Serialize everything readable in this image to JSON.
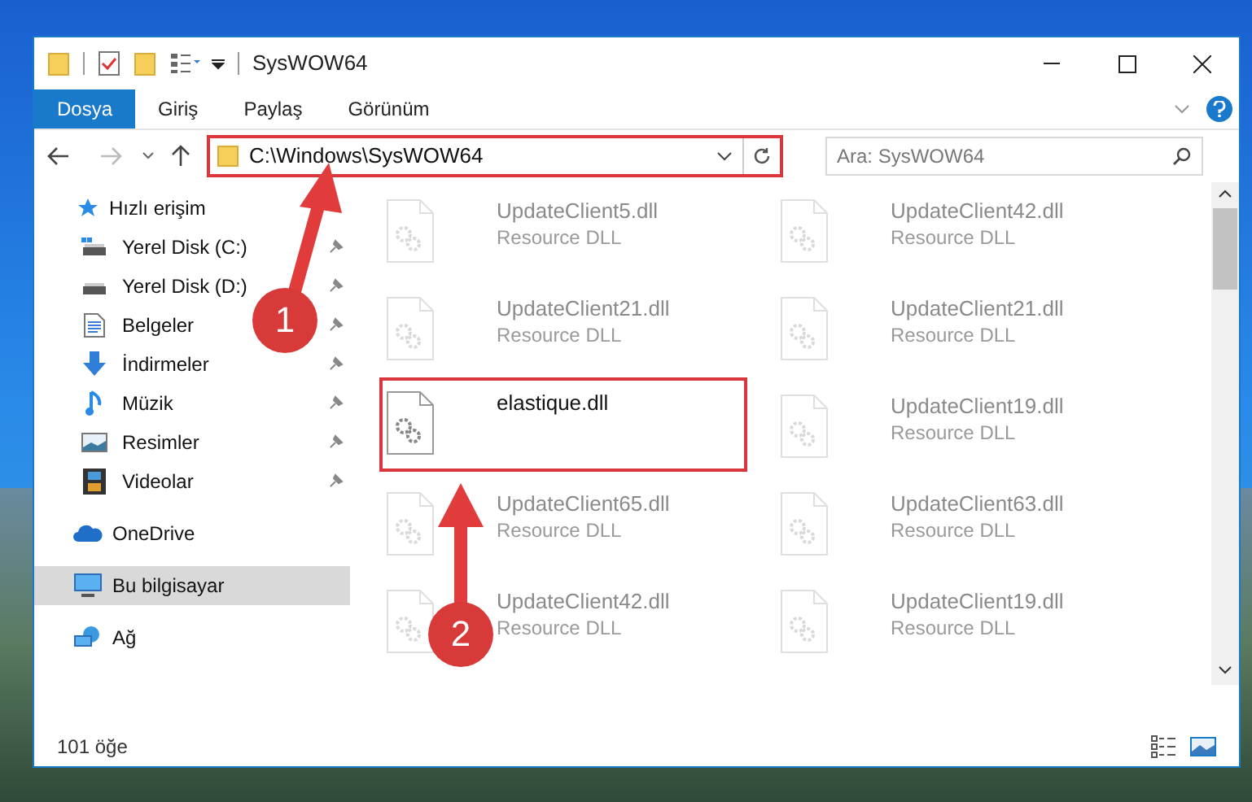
{
  "window": {
    "title": "SysWOW64"
  },
  "ribbon_tabs": [
    {
      "label": "Dosya",
      "selected": true
    },
    {
      "label": "Giriş",
      "selected": false
    },
    {
      "label": "Paylaş",
      "selected": false
    },
    {
      "label": "Görünüm",
      "selected": false
    }
  ],
  "address": {
    "path": "C:\\Windows\\SysWOW64",
    "highlighted": true
  },
  "search": {
    "placeholder": "Ara: SysWOW64"
  },
  "nav": {
    "quick_access": "Hızlı erişim",
    "pinned": [
      {
        "label": "Yerel Disk (C:)",
        "kind": "drive-c"
      },
      {
        "label": "Yerel Disk (D:)",
        "kind": "drive"
      },
      {
        "label": "Belgeler",
        "kind": "document"
      },
      {
        "label": "İndirmeler",
        "kind": "download"
      },
      {
        "label": "Müzik",
        "kind": "music"
      },
      {
        "label": "Resimler",
        "kind": "picture"
      },
      {
        "label": "Videolar",
        "kind": "video"
      }
    ],
    "others": [
      {
        "label": "OneDrive",
        "kind": "cloud",
        "selected": false
      },
      {
        "label": "Bu bilgisayar",
        "kind": "pc",
        "selected": true
      },
      {
        "label": "Ağ",
        "kind": "network",
        "selected": false
      }
    ]
  },
  "files": [
    {
      "name": "UpdateClient5.dll",
      "type": "Resource DLL",
      "faded": true,
      "highlighted": false
    },
    {
      "name": "UpdateClient42.dll",
      "type": "Resource DLL",
      "faded": true,
      "highlighted": false
    },
    {
      "name": "UpdateClient21.dll",
      "type": "Resource DLL",
      "faded": true,
      "highlighted": false
    },
    {
      "name": "UpdateClient21.dll",
      "type": "Resource DLL",
      "faded": true,
      "highlighted": false
    },
    {
      "name": "elastique.dll",
      "faded": false,
      "highlighted": true
    },
    {
      "name": "UpdateClient19.dll",
      "type": "Resource DLL",
      "faded": true,
      "highlighted": false
    },
    {
      "name": "UpdateClient65.dll",
      "type": "Resource DLL",
      "faded": true,
      "highlighted": false
    },
    {
      "name": "UpdateClient63.dll",
      "type": "Resource DLL",
      "faded": true,
      "highlighted": false
    },
    {
      "name": "UpdateClient42.dll",
      "type": "Resource DLL",
      "faded": true,
      "highlighted": false
    },
    {
      "name": "UpdateClient19.dll",
      "type": "Resource DLL",
      "faded": true,
      "highlighted": false
    }
  ],
  "status_bar": {
    "count": "101 öğe"
  },
  "annotations": [
    {
      "number": "1"
    },
    {
      "number": "2"
    }
  ]
}
